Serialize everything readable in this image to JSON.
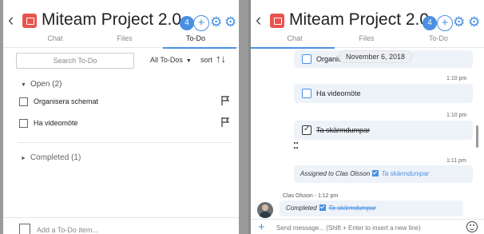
{
  "left": {
    "header": {
      "back": "‹",
      "title": "Miteam Project 2.0",
      "member_count": "4",
      "add": "+"
    },
    "tabs": [
      {
        "label": "Chat"
      },
      {
        "label": "Files"
      },
      {
        "label": "To-Do"
      }
    ],
    "active_tab": "To-Do",
    "search": {
      "placeholder": "Search To-Do"
    },
    "filter": {
      "label": "All To-Dos",
      "caret": "▼"
    },
    "sort": {
      "label": "sort",
      "icon": "↑↓"
    },
    "open_section": {
      "label": "Open (2)",
      "arrow": "▼"
    },
    "todos": [
      {
        "label": "Organisera schemat",
        "checked": false
      },
      {
        "label": "Ha videomöte",
        "checked": false
      }
    ],
    "completed_section": {
      "label": "Completed (1)",
      "arrow": "►"
    },
    "add_todo": {
      "placeholder": "Add a To-Do item..."
    }
  },
  "right": {
    "header": {
      "back": "‹",
      "title": "Miteam Project 2.0",
      "member_count": "4",
      "add": "+"
    },
    "tabs": [
      {
        "label": "Chat"
      },
      {
        "label": "Files"
      },
      {
        "label": "To-Do"
      }
    ],
    "active_tab": "Chat",
    "date_pill": "November 6, 2018",
    "messages": [
      {
        "type": "todo",
        "label": "Organise",
        "checked": false,
        "completed": false
      },
      {
        "type": "time",
        "text": "1:10 pm"
      },
      {
        "type": "todo",
        "label": "Ha videomöte",
        "checked": false,
        "completed": false
      },
      {
        "type": "time",
        "text": "1:10 pm"
      },
      {
        "type": "todo",
        "label": "Ta skärmdumpar",
        "checked": true,
        "completed": true
      },
      {
        "type": "time",
        "text": "1:11 pm"
      },
      {
        "type": "system",
        "prefix": "Assigned to Clas Olsson",
        "link": "Ta skärmdumpar"
      }
    ],
    "sender": "Clas Olsson - 1:12 pm",
    "completed_msg": {
      "prefix": "Completed",
      "link": "Ta skärmdumpar"
    },
    "composer": {
      "plus": "+",
      "placeholder": "Send message... (Shift + Enter to insert a new line)"
    }
  },
  "colors": {
    "accent": "#4a90e2",
    "logo": "#e8544f",
    "bubble": "#eef3f9"
  },
  "icons": [
    "back-icon",
    "app-logo-icon",
    "add-member-icon",
    "gear-icon",
    "settings-icon",
    "flag-icon",
    "emoji-icon",
    "plus-icon"
  ]
}
